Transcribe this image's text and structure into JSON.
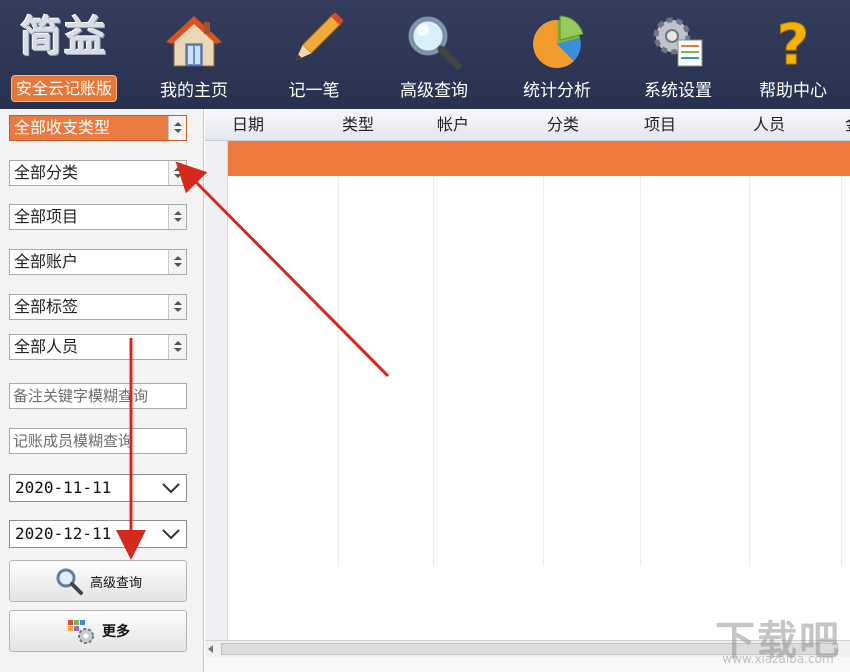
{
  "logo": {
    "title": "简益",
    "badge": "安全云记账版"
  },
  "nav": [
    {
      "label": "我的主页",
      "icon": "home-icon"
    },
    {
      "label": "记一笔",
      "icon": "pencil-icon"
    },
    {
      "label": "高级查询",
      "icon": "magnifier-icon"
    },
    {
      "label": "统计分析",
      "icon": "pie-chart-icon"
    },
    {
      "label": "系统设置",
      "icon": "gear-icon"
    },
    {
      "label": "帮助中心",
      "icon": "help-icon"
    }
  ],
  "filters": {
    "type": "全部收支类型",
    "category": "全部分类",
    "project": "全部项目",
    "account": "全部账户",
    "tag": "全部标签",
    "person": "全部人员",
    "remark_placeholder": "备注关键字模糊查询",
    "member_placeholder": "记账成员模糊查询",
    "date_from": "2020-11-11",
    "date_to": "2020-12-11"
  },
  "buttons": {
    "search": "高级查询",
    "more": "更多"
  },
  "grid": {
    "columns": [
      "日期",
      "类型",
      "帐户",
      "分类",
      "项目",
      "人员",
      "金"
    ]
  },
  "colors": {
    "accent": "#ed7a3c",
    "toolbar": "#2b3553",
    "annotation": "#d42a1e"
  },
  "watermark": {
    "text": "下载吧",
    "url": "www.xiazaiba.com"
  }
}
